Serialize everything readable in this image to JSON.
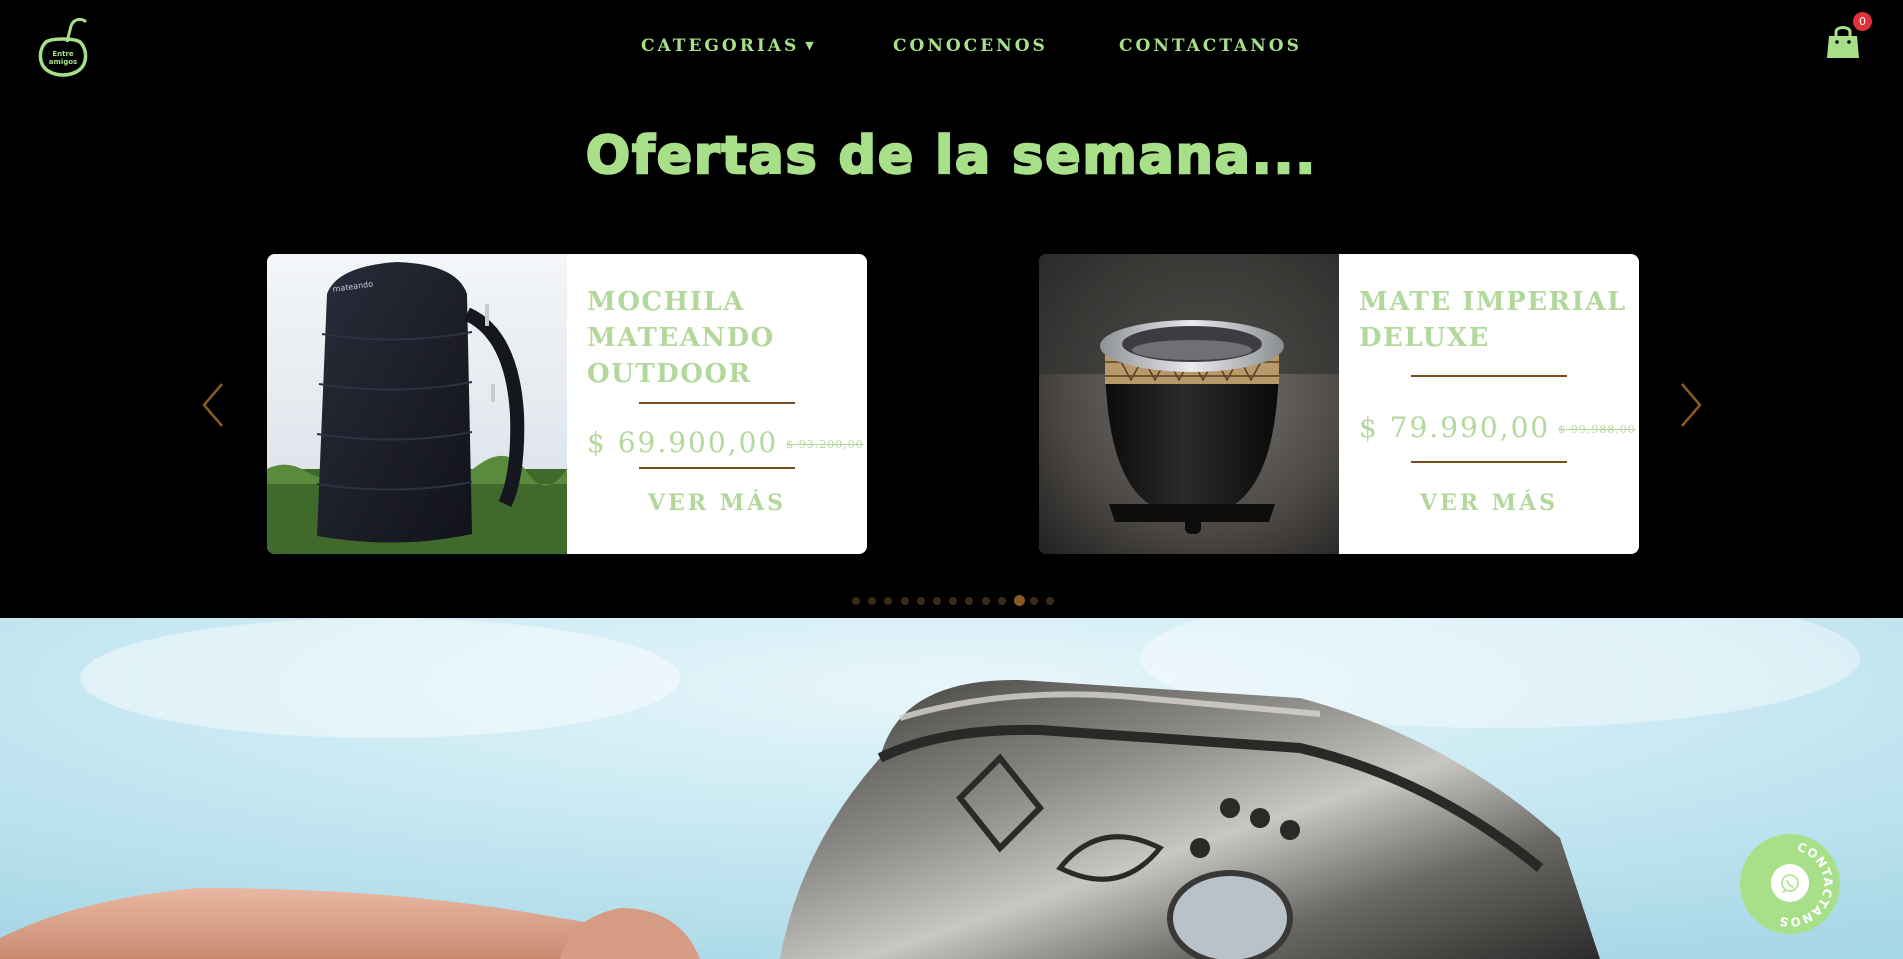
{
  "brand": {
    "logo_text": "Entre amigos"
  },
  "nav": {
    "categorias": "CATEGORIAS",
    "categorias_caret": "▼",
    "conocenos": "CONOCENOS",
    "contactanos": "CONTACTANOS"
  },
  "cart": {
    "count": "0"
  },
  "offers": {
    "title": "Ofertas de la semana...",
    "products": [
      {
        "title": "MOCHILA MATEANDO OUTDOOR",
        "price": "$ 69.900,00",
        "old_price": "$ 93.200,00",
        "cta": "VER MÁS",
        "image_brand": "mateando"
      },
      {
        "title": "MATE IMPERIAL DELUXE",
        "price": "$ 79.990,00",
        "old_price": "$ 99.988,00",
        "cta": "VER MÁS"
      }
    ],
    "dots_total": 13,
    "dots_active_index": 10
  },
  "contact_fab": {
    "label": "CONTACTANOS"
  },
  "colors": {
    "accent": "#a8e08a",
    "brown": "#7a4d1c",
    "badge": "#e0323a",
    "background": "#000000"
  }
}
